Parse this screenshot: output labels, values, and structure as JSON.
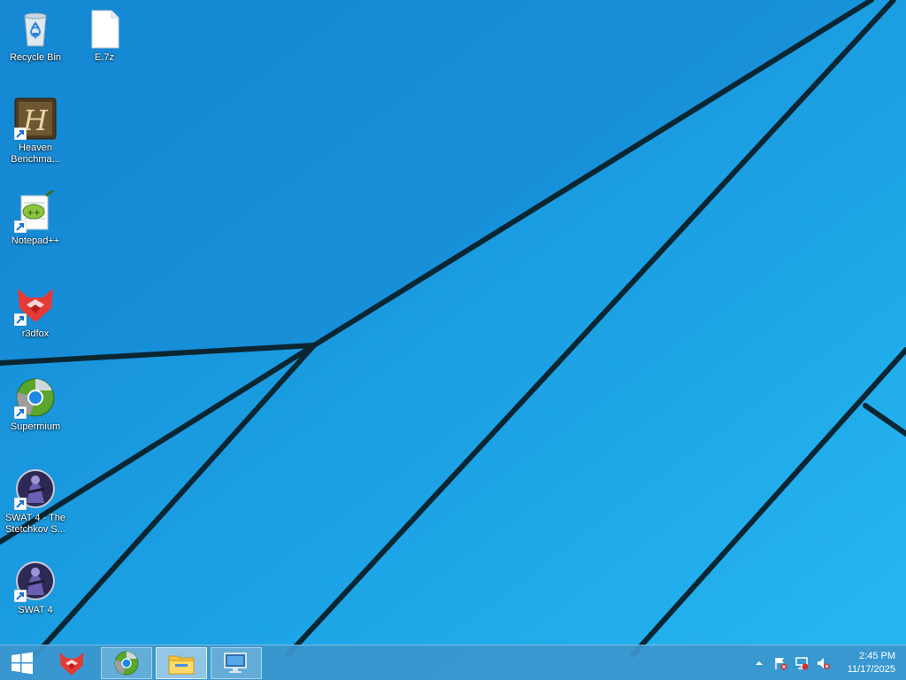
{
  "desktop": {
    "icons": [
      {
        "label": "Recycle Bin",
        "icon": "recycle-bin-icon"
      },
      {
        "label": "E.7z",
        "icon": "file-icon"
      },
      {
        "label": "Heaven Benchma...",
        "icon": "heaven-benchmark-icon"
      },
      {
        "label": "Notepad++",
        "icon": "notepad-plus-plus-icon"
      },
      {
        "label": "r3dfox",
        "icon": "r3dfox-icon"
      },
      {
        "label": "Supermium",
        "icon": "supermium-icon"
      },
      {
        "label": "SWAT 4 - The Stetchkov S...",
        "icon": "swat4-icon"
      },
      {
        "label": "SWAT 4",
        "icon": "swat4-icon"
      }
    ],
    "colors": {
      "wallpaper": "#1d9fe3",
      "lines": "#0a2633"
    }
  },
  "taskbar": {
    "start_icon": "windows-logo-icon",
    "pinned": [
      {
        "name": "r3dfox",
        "icon": "r3dfox-icon",
        "state": "pinned"
      },
      {
        "name": "Supermium",
        "icon": "supermium-icon",
        "state": "open"
      },
      {
        "name": "File Explorer",
        "icon": "folder-icon",
        "state": "active"
      },
      {
        "name": "Remote Desktop",
        "icon": "monitor-icon",
        "state": "open"
      }
    ],
    "tray": {
      "icons": [
        "chevron-up-icon",
        "action-center-flag-icon",
        "network-icon",
        "volume-muted-icon"
      ],
      "time": "2:45 PM",
      "date": "11/17/2025"
    },
    "color": "#3c96cd"
  }
}
